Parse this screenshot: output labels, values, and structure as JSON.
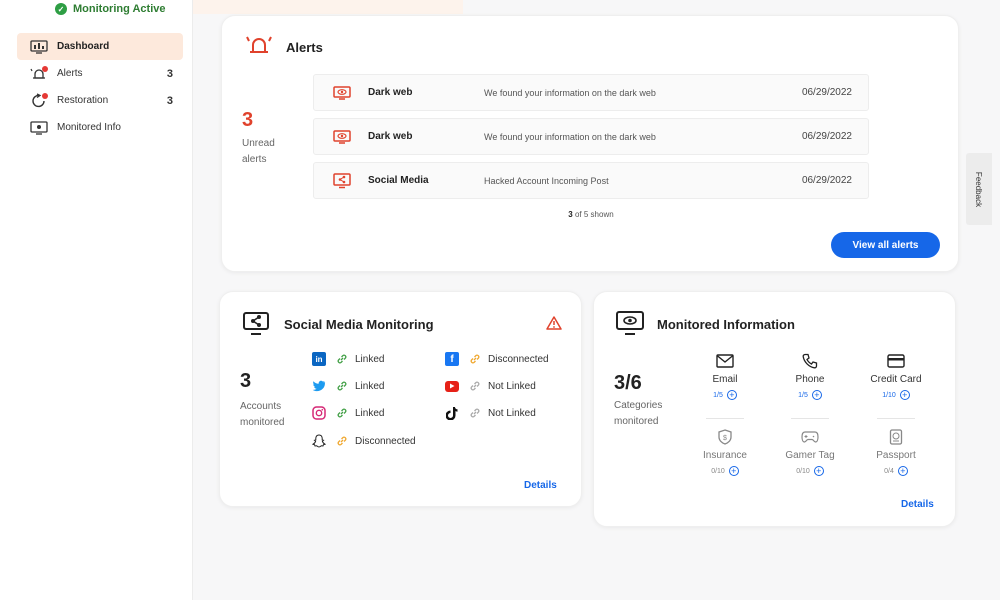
{
  "sidebar": {
    "status": "Monitoring Active",
    "items": [
      {
        "label": "Dashboard",
        "count": ""
      },
      {
        "label": "Alerts",
        "count": "3"
      },
      {
        "label": "Restoration",
        "count": "3"
      },
      {
        "label": "Monitored Info",
        "count": ""
      }
    ]
  },
  "alerts": {
    "title": "Alerts",
    "count": "3",
    "count_label": "Unread alerts",
    "rows": [
      {
        "type": "Dark web",
        "desc": "We found your information on the dark web",
        "date": "06/29/2022"
      },
      {
        "type": "Dark web",
        "desc": "We found your information on the dark web",
        "date": "06/29/2022"
      },
      {
        "type": "Social Media",
        "desc": "Hacked Account Incoming Post",
        "date": "06/29/2022"
      }
    ],
    "shown_num": "3",
    "shown_rest": "of 5 shown",
    "view_all": "View all alerts"
  },
  "social": {
    "title": "Social Media Monitoring",
    "count": "3",
    "count_label": "Accounts monitored",
    "items": [
      {
        "network": "in",
        "status": "Linked"
      },
      {
        "network": "tw",
        "status": "Linked"
      },
      {
        "network": "ig",
        "status": "Linked"
      },
      {
        "network": "sc",
        "status": "Disconnected"
      },
      {
        "network": "f",
        "status": "Disconnected"
      },
      {
        "network": "yt",
        "status": "Not Linked"
      },
      {
        "network": "tk",
        "status": "Not Linked"
      }
    ],
    "details": "Details"
  },
  "info": {
    "title": "Monitored Information",
    "count": "3/6",
    "count_label": "Categories monitored",
    "cells": [
      {
        "label": "Email",
        "count": "1/5"
      },
      {
        "label": "Phone",
        "count": "1/5"
      },
      {
        "label": "Credit Card",
        "count": "1/10"
      },
      {
        "label": "Insurance",
        "count": "0/10"
      },
      {
        "label": "Gamer Tag",
        "count": "0/10"
      },
      {
        "label": "Passport",
        "count": "0/4"
      }
    ],
    "details": "Details"
  },
  "feedback": "Feedback",
  "colors": {
    "accent": "#1667e8",
    "alert_red": "#e0422c",
    "active_bg": "#fde9dc",
    "status_green": "#2e9e44"
  }
}
